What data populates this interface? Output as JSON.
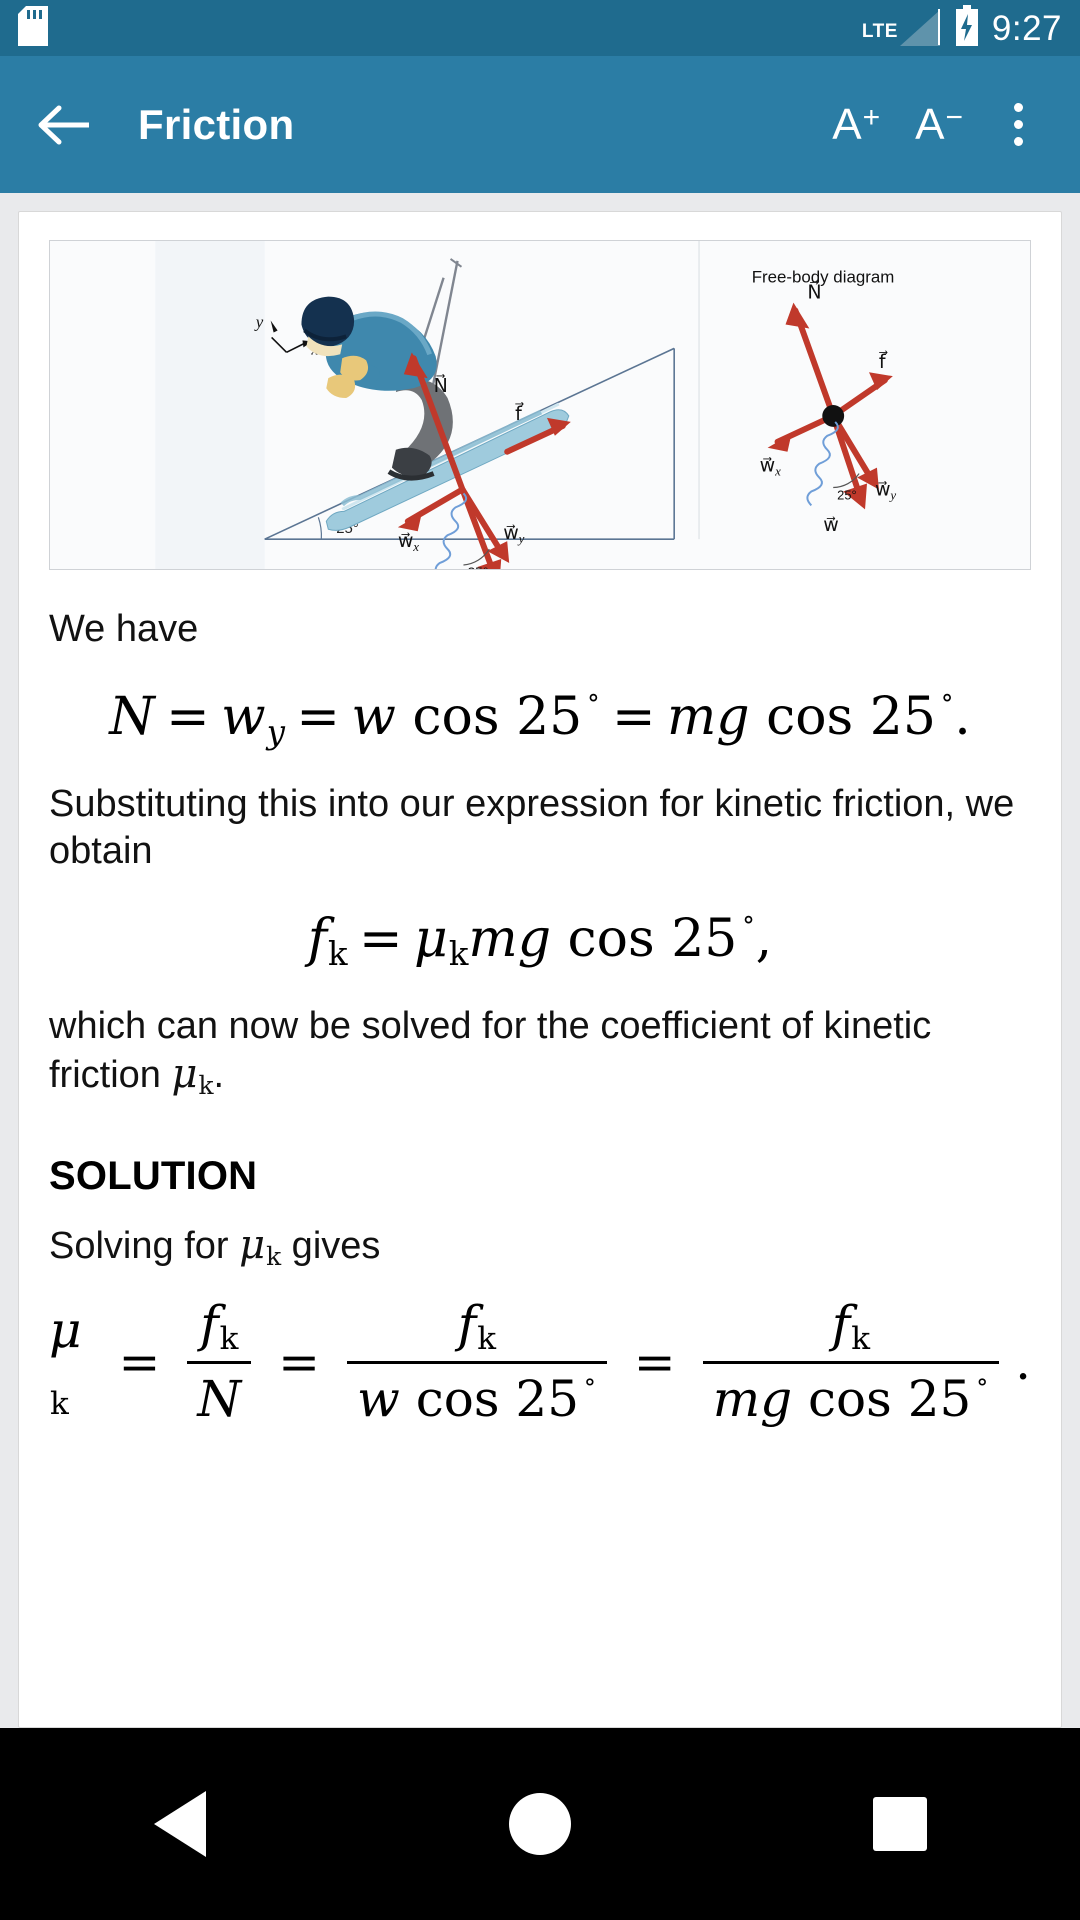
{
  "status_bar": {
    "sd_card_icon": "sd-card-icon",
    "network_label": "LTE",
    "signal_icon": "signal-bars-icon",
    "battery_icon": "battery-charging-icon",
    "time": "9:27"
  },
  "app_bar": {
    "back_icon": "arrow-left-icon",
    "title": "Friction",
    "increase_font_label": "A",
    "increase_font_sup": "+",
    "decrease_font_label": "A",
    "decrease_font_sup": "−",
    "overflow_icon": "more-vertical-icon"
  },
  "figure": {
    "caption": "Free-body diagram",
    "axis_y": "y",
    "axis_x": "x",
    "labels": {
      "normal": "N",
      "friction": "f",
      "weight": "w",
      "weight_x": "w",
      "weight_x_sub": "x",
      "weight_y": "w",
      "weight_y_sub": "y"
    },
    "angle_incline": "25°",
    "angle_weight": "25°",
    "angle_fbd": "25°",
    "colors": {
      "vector_red": "#c0392b",
      "ski_blue": "#8dc3d8",
      "jacket_blue": "#3f88ad",
      "helmet_blue": "#14314f",
      "pants_gray": "#6f7276",
      "incline_line": "#5b7593",
      "boot_yellow": "#e8c87a"
    }
  },
  "content": {
    "p1": "We have",
    "eq1": {
      "N": "N",
      "eq": "=",
      "w": "w",
      "w_sub": "y",
      "w2": "w",
      "cos": "cos",
      "angle": "25",
      "deg": "˚",
      "m": "m",
      "g": "g",
      "cos2": "cos",
      "angle2": "25",
      "period": "."
    },
    "p2": "Substituting this into our expression for kinetic friction, we obtain",
    "eq2": {
      "f": "f",
      "f_sub": "k",
      "eq": "=",
      "mu": "μ",
      "mu_sub": "k",
      "m": "m",
      "g": "g",
      "cos": "cos",
      "angle": "25",
      "deg": "˚",
      "comma": ","
    },
    "p3_a": "which can now be solved for the coefficient of kinetic friction ",
    "p3_mu": "μ",
    "p3_mu_sub": "k",
    "p3_b": ".",
    "solution_heading": "SOLUTION",
    "p4_a": "Solving for ",
    "p4_mu": "μ",
    "p4_mu_sub": "k",
    "p4_b": " gives",
    "eq3": {
      "mu": "μ",
      "mu_sub": "k",
      "eq1": "=",
      "num1_f": "f",
      "num1_sub": "k",
      "den1": "N",
      "eq2": "=",
      "num2_f": "f",
      "num2_sub": "k",
      "den2_w": "w",
      "den2_cos": "cos",
      "den2_angle": "25",
      "den2_deg": "˚",
      "eq3": "=",
      "num3_f": "f",
      "num3_sub": "k",
      "den3_m": "m",
      "den3_g": "g",
      "den3_cos": "cos",
      "den3_angle": "25",
      "den3_deg": "˚",
      "period": "."
    }
  },
  "nav_bar": {
    "back_icon": "nav-back-triangle-icon",
    "home_icon": "nav-home-circle-icon",
    "recents_icon": "nav-recents-square-icon"
  },
  "theme": {
    "status_bar_color": "#1f6b8e",
    "app_bar_color": "#2b7da5",
    "page_bg": "#e9eaec",
    "card_bg": "#ffffff",
    "text_color": "#121212",
    "nav_bar_color": "#000000"
  }
}
